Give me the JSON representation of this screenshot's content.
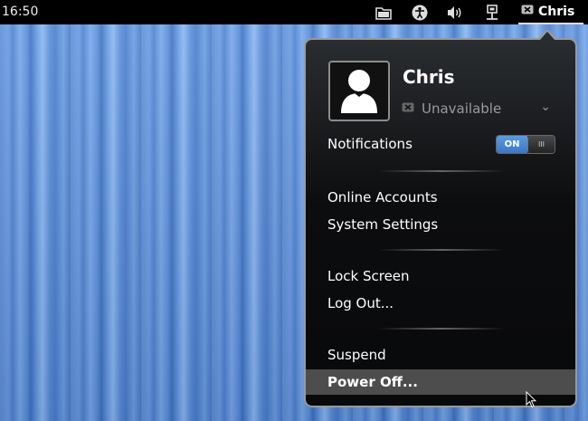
{
  "topbar": {
    "clock": "16:50",
    "tray_icons": [
      "folder-icon",
      "accessibility-icon",
      "volume-icon",
      "network-icon"
    ],
    "user_button": {
      "name": "Chris",
      "status_icon": "unavailable-status-icon"
    }
  },
  "menu": {
    "user": {
      "name": "Chris",
      "avatar_icon": "user-silhouette-icon",
      "status": "Unavailable",
      "status_icon": "unavailable-status-icon",
      "status_chevron": "chevron-down-icon"
    },
    "notifications": {
      "label": "Notifications",
      "toggle_on_label": "ON",
      "toggle_state": true
    },
    "items_group1": [
      "Online Accounts",
      "System Settings"
    ],
    "items_group2": [
      "Lock Screen",
      "Log Out..."
    ],
    "items_group3": [
      "Suspend",
      "Power Off..."
    ],
    "highlighted_item": "Power Off..."
  },
  "colors": {
    "toggle_on": "#4a8ad8",
    "menu_bg": "#0c0d0f",
    "highlight": "#4d4d4d",
    "wallpaper": "#5e8fd8"
  }
}
